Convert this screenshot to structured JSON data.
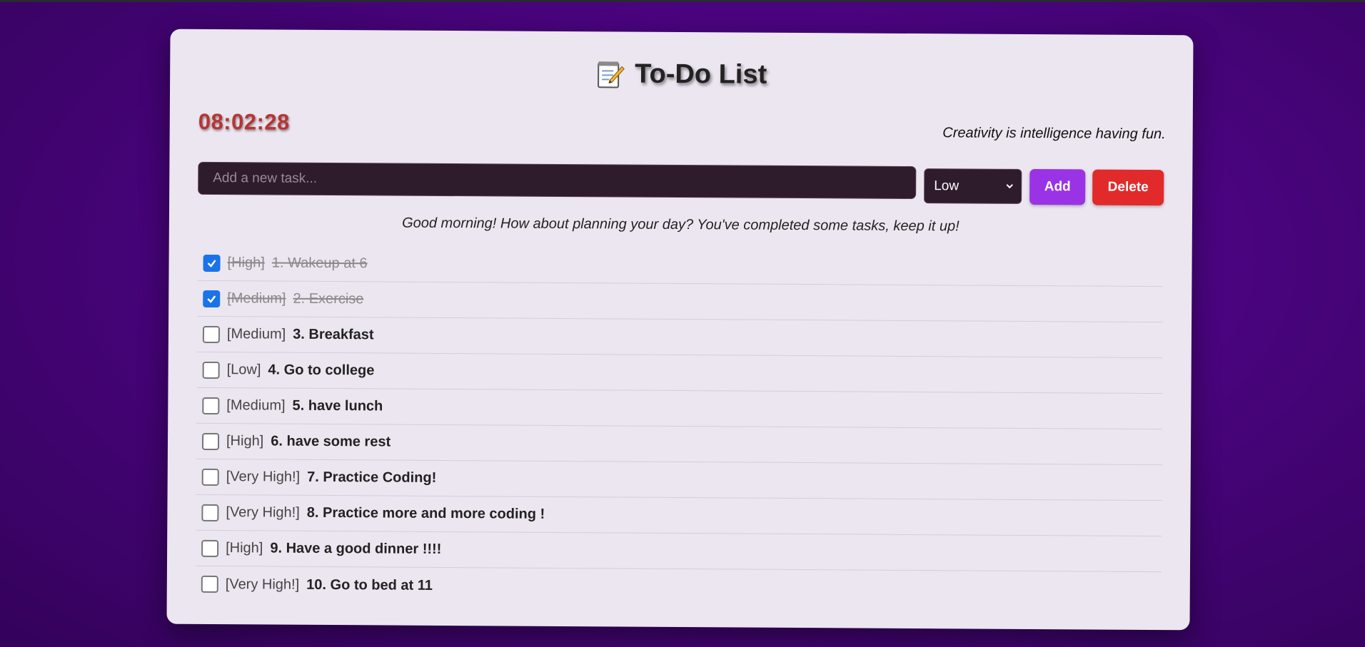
{
  "app": {
    "title": "To-Do List",
    "clock": "08:02:28",
    "quote": "Creativity is intelligence having fun."
  },
  "form": {
    "placeholder": "Add a new task...",
    "priority_selected": "Low",
    "add_label": "Add",
    "delete_label": "Delete"
  },
  "greeting": "Good morning! How about planning your day? You've completed some tasks, keep it up!",
  "tasks": [
    {
      "priority": "[High]",
      "text": "1. Wakeup at 6",
      "done": true
    },
    {
      "priority": "[Medium]",
      "text": "2. Exercise",
      "done": true
    },
    {
      "priority": "[Medium]",
      "text": "3. Breakfast",
      "done": false
    },
    {
      "priority": "[Low]",
      "text": "4. Go to college",
      "done": false
    },
    {
      "priority": "[Medium]",
      "text": "5. have lunch",
      "done": false
    },
    {
      "priority": "[High]",
      "text": "6. have some rest",
      "done": false
    },
    {
      "priority": "[Very High!]",
      "text": "7. Practice Coding!",
      "done": false
    },
    {
      "priority": "[Very High!]",
      "text": "8. Practice more and more coding !",
      "done": false
    },
    {
      "priority": "[High]",
      "text": "9. Have a good dinner !!!!",
      "done": false
    },
    {
      "priority": "[Very High!]",
      "text": "10. Go to bed at 11",
      "done": false
    }
  ],
  "colors": {
    "accent_add": "#9a33e6",
    "accent_delete": "#e22a2a",
    "clock": "#b83434",
    "checkbox_checked": "#1a73e8"
  }
}
